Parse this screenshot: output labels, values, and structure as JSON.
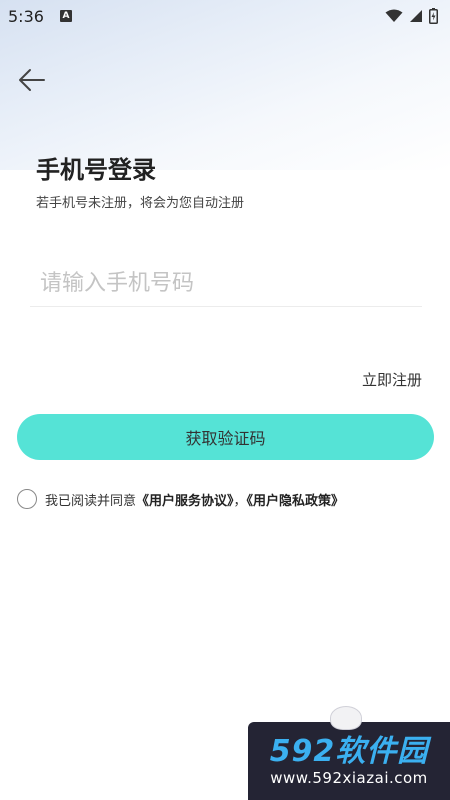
{
  "status_bar": {
    "time": "5:36",
    "notification_badge": "A",
    "icons": [
      "wifi-icon",
      "signal-icon",
      "battery-icon"
    ]
  },
  "header": {
    "back_icon": "arrow-left-icon"
  },
  "login": {
    "title": "手机号登录",
    "subtitle": "若手机号未注册，将会为您自动注册",
    "phone_placeholder": "请输入手机号码",
    "phone_value": "",
    "register_label": "立即注册",
    "get_code_label": "获取验证码"
  },
  "agreement": {
    "prefix": "我已阅读并同意",
    "user_agreement": "《用户服务协议》",
    "separator": "，",
    "privacy_policy": "《用户隐私政策》",
    "checked": false
  },
  "watermark": {
    "logo": "592软件园",
    "url": "www.592xiazai.com"
  },
  "colors": {
    "primary_button": "#55e3d6",
    "watermark_bg": "#242434",
    "watermark_logo": "#3bb0f0"
  }
}
